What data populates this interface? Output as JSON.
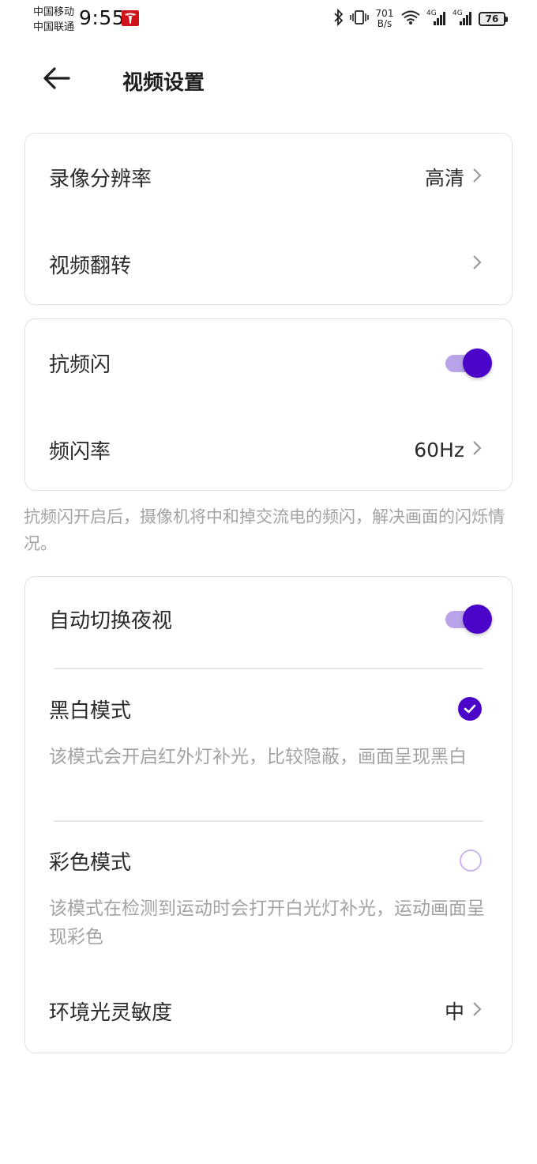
{
  "status_bar": {
    "carrier1": "中国移动",
    "carrier2": "中国联通",
    "time": "9:55",
    "net_speed_value": "701",
    "net_speed_unit": "B/s",
    "signal1": "4G",
    "signal2": "4G",
    "battery": "76"
  },
  "header": {
    "title": "视频设置",
    "back_icon": "arrow-left-icon"
  },
  "card1": {
    "resolution_label": "录像分辨率",
    "resolution_value": "高清",
    "flip_label": "视频翻转"
  },
  "card2": {
    "antiflicker_label": "抗频闪",
    "antiflicker_on": true,
    "rate_label": "频闪率",
    "rate_value": "60Hz"
  },
  "antiflicker_note": "抗频闪开启后，摄像机将中和掉交流电的频闪，解决画面的闪烁情况。",
  "card3": {
    "auto_night_label": "自动切换夜视",
    "auto_night_on": true,
    "bw_label": "黑白模式",
    "bw_selected": true,
    "bw_desc": "该模式会开启红外灯补光，比较隐蔽，画面呈现黑白",
    "color_label": "彩色模式",
    "color_selected": false,
    "color_desc": "该模式在检测到运动时会打开白光灯补光，运动画面呈现彩色",
    "sensitivity_label": "环境光灵敏度",
    "sensitivity_value": "中"
  },
  "colors": {
    "accent": "#4b05c9",
    "toggle_track": "#b9a3e8",
    "helper_text": "#a3a3a3"
  }
}
